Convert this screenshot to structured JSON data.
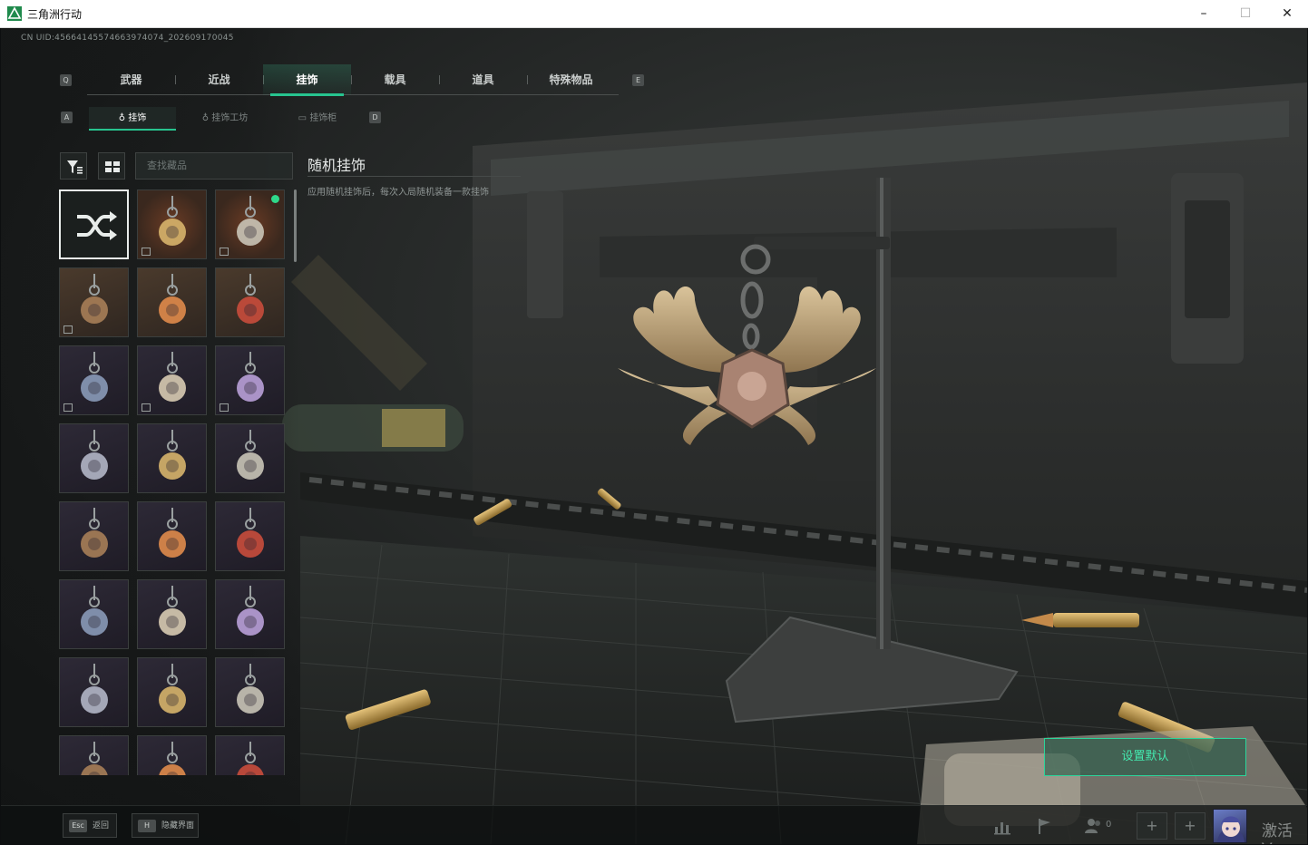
{
  "window": {
    "title": "三角洲行动",
    "minimize": "–",
    "maximize": "☐",
    "close": "✕"
  },
  "uid": "CN UID:456641455746639740​74_202609170045",
  "main_tabs": {
    "prev_key": "Q",
    "next_key": "E",
    "items": [
      {
        "label": "武器"
      },
      {
        "label": "近战"
      },
      {
        "label": "挂饰"
      },
      {
        "label": "载具"
      },
      {
        "label": "道具"
      },
      {
        "label": "特殊物品"
      }
    ],
    "active_index": 2
  },
  "sub_tabs": {
    "prev_key": "A",
    "next_key": "D",
    "items": [
      {
        "label": "挂饰",
        "icon": "charm-icon"
      },
      {
        "label": "挂饰工坊",
        "icon": "charm-icon"
      },
      {
        "label": "挂饰柜",
        "icon": "cabinet-icon"
      }
    ],
    "active_index": 0
  },
  "search": {
    "placeholder": "查找藏品"
  },
  "grid": {
    "items": [
      {
        "icon": "shuffle-icon",
        "bg": "dark",
        "selected": true,
        "badge": false,
        "dot": false
      },
      {
        "icon": "purple-orb-charm-icon",
        "bg": "orange",
        "badge": true,
        "dot": false
      },
      {
        "icon": "lantern-charm-icon",
        "bg": "orange",
        "badge": true,
        "dot": true
      },
      {
        "icon": "medal-charm-icon",
        "bg": "brown",
        "badge": true,
        "dot": false
      },
      {
        "icon": "canister-charm-icon",
        "bg": "brown",
        "badge": false,
        "dot": false
      },
      {
        "icon": "disco-ball-charm-icon",
        "bg": "brown",
        "badge": false,
        "dot": false
      },
      {
        "icon": "gold-skull-charm-icon",
        "bg": "purple",
        "badge": true,
        "dot": false
      },
      {
        "icon": "ticket-charm-icon",
        "bg": "purple",
        "badge": true,
        "dot": false
      },
      {
        "icon": "tag-charm-icon",
        "bg": "purple",
        "badge": true,
        "dot": false
      },
      {
        "icon": "number-2-charm-icon",
        "bg": "purple",
        "badge": false,
        "dot": false
      },
      {
        "icon": "boot-charm-icon",
        "bg": "purple",
        "badge": false,
        "dot": false
      },
      {
        "icon": "paper-charm-icon",
        "bg": "purple",
        "badge": false,
        "dot": false
      },
      {
        "icon": "shoe-charm-icon",
        "bg": "purple",
        "badge": false,
        "dot": false
      },
      {
        "icon": "dumbbell-charm-icon",
        "bg": "purple",
        "badge": false,
        "dot": false
      },
      {
        "icon": "frame-charm-icon",
        "bg": "purple",
        "badge": false,
        "dot": false
      },
      {
        "icon": "fish-charm-icon",
        "bg": "purple",
        "badge": false,
        "dot": false
      },
      {
        "icon": "red-bird-charm-icon",
        "bg": "purple",
        "badge": false,
        "dot": false
      },
      {
        "icon": "figure-charm-icon",
        "bg": "purple",
        "badge": false,
        "dot": false
      },
      {
        "icon": "plate-charm-icon",
        "bg": "purple",
        "badge": false,
        "dot": false
      },
      {
        "icon": "flower-charm-icon",
        "bg": "purple",
        "badge": false,
        "dot": false
      },
      {
        "icon": "red-orb-charm-icon",
        "bg": "purple",
        "badge": false,
        "dot": false
      },
      {
        "icon": "teapot-charm-icon",
        "bg": "purple",
        "badge": false,
        "dot": false
      },
      {
        "icon": "butterfly-charm-icon",
        "bg": "purple",
        "badge": false,
        "dot": false
      },
      {
        "icon": "crescent-charm-icon",
        "bg": "purple",
        "badge": false,
        "dot": false
      }
    ]
  },
  "detail": {
    "title": "随机挂饰",
    "description": "应用随机挂饰后，每次入局随机装备一款挂饰"
  },
  "set_default_label": "设置默认",
  "bottom": {
    "hints": [
      {
        "key": "Esc",
        "label": "返回"
      },
      {
        "key": "H",
        "label": "隐藏界面"
      }
    ],
    "friend_count": "0",
    "activate_text": "激活 V"
  },
  "colors": {
    "accent": "#27c48f",
    "accent_text": "#44e8ae",
    "new_dot": "#2fd88a"
  }
}
